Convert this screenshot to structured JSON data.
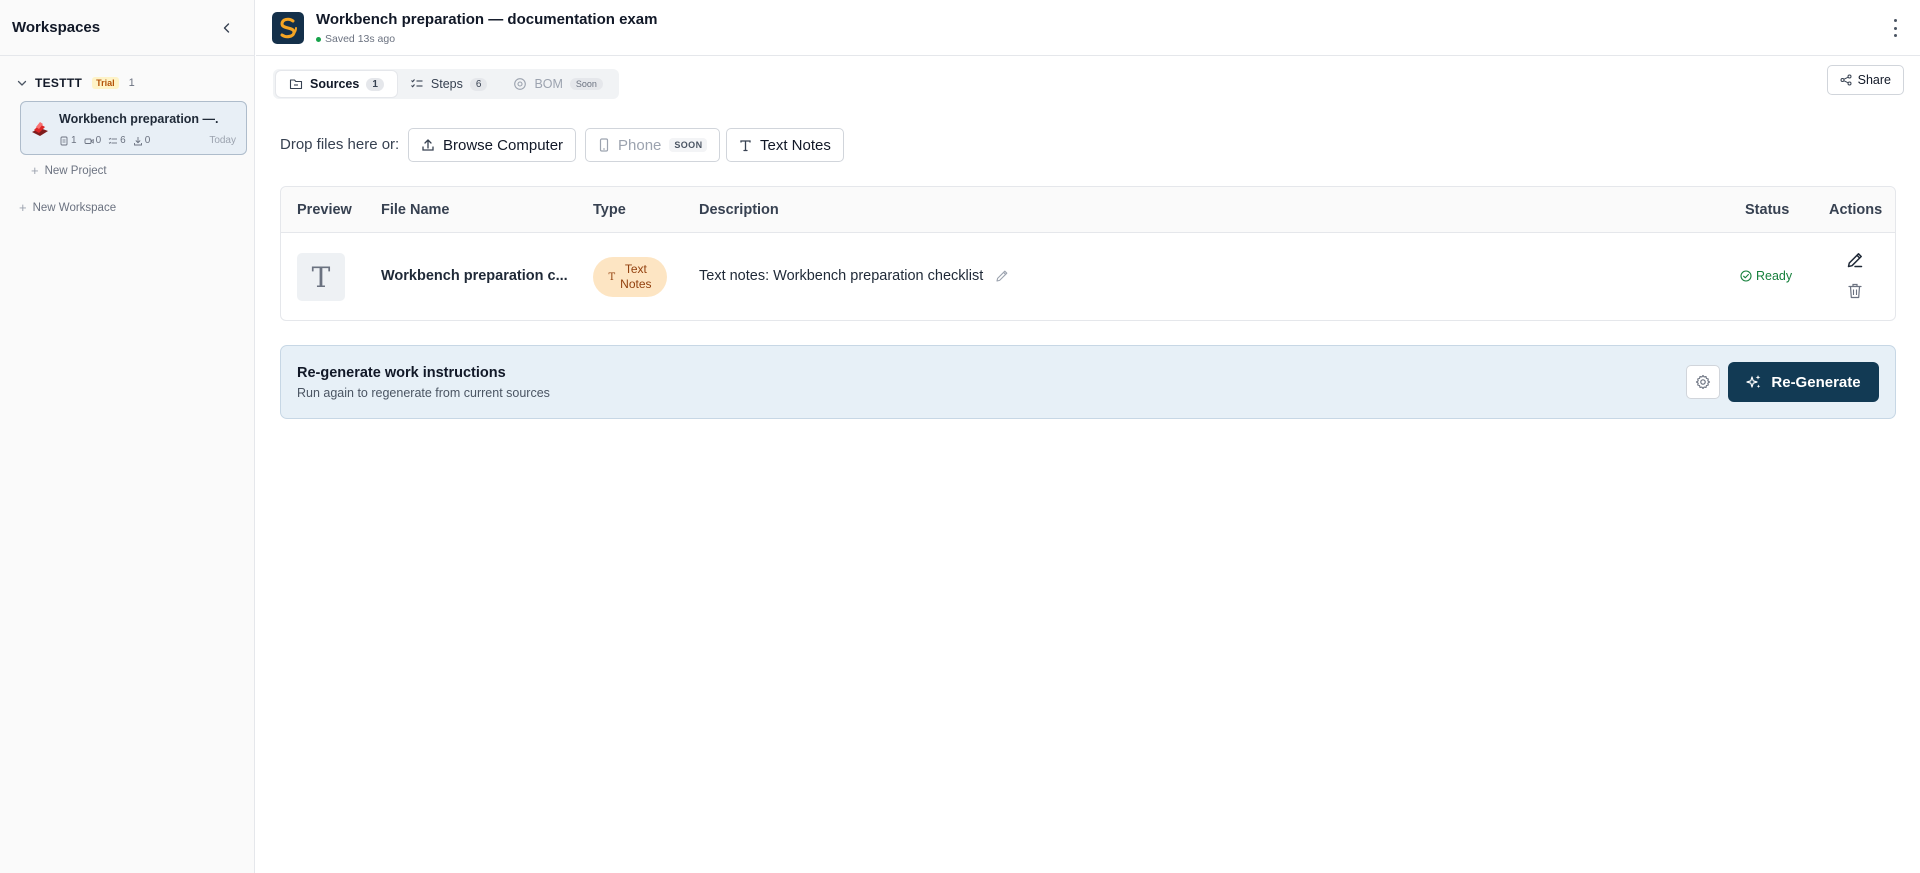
{
  "sidebar": {
    "title": "Workspaces",
    "workspace": {
      "name": "TESTTT",
      "badge": "Trial",
      "count": "1"
    },
    "project": {
      "name": "Workbench preparation —...",
      "stats": {
        "sources": "1",
        "videos": "0",
        "steps": "6",
        "downloads": "0"
      },
      "date": "Today"
    },
    "new_project": "New Project",
    "new_workspace": "New Workspace"
  },
  "header": {
    "title": "Workbench preparation — documentation exam",
    "saved": "Saved 13s ago",
    "logo_icon": "app-logo-icon"
  },
  "tabs": [
    {
      "label": "Sources",
      "count": "1"
    },
    {
      "label": "Steps",
      "count": "6"
    },
    {
      "label": "BOM",
      "badge": "Soon"
    }
  ],
  "share_label": "Share",
  "upload": {
    "label": "Drop files here or:",
    "browse": "Browse Computer",
    "phone": "Phone",
    "phone_badge": "SOON",
    "text_notes": "Text Notes"
  },
  "table": {
    "headers": {
      "preview": "Preview",
      "file_name": "File Name",
      "type": "Type",
      "description": "Description",
      "status": "Status",
      "actions": "Actions"
    },
    "rows": [
      {
        "preview_glyph": "T",
        "file_name": "Workbench preparation c...",
        "type_line1": "Text",
        "type_line2": "Notes",
        "description": "Text notes: Workbench preparation checklist",
        "status": "Ready"
      }
    ]
  },
  "regenerate": {
    "title": "Re-generate work instructions",
    "subtitle": "Run again to regenerate from current sources",
    "button": "Re-Generate"
  },
  "colors": {
    "accent": "#123a54",
    "ready": "#16803c",
    "type_pill": "#fde5c3",
    "trial_badge": "#fef3c7"
  }
}
